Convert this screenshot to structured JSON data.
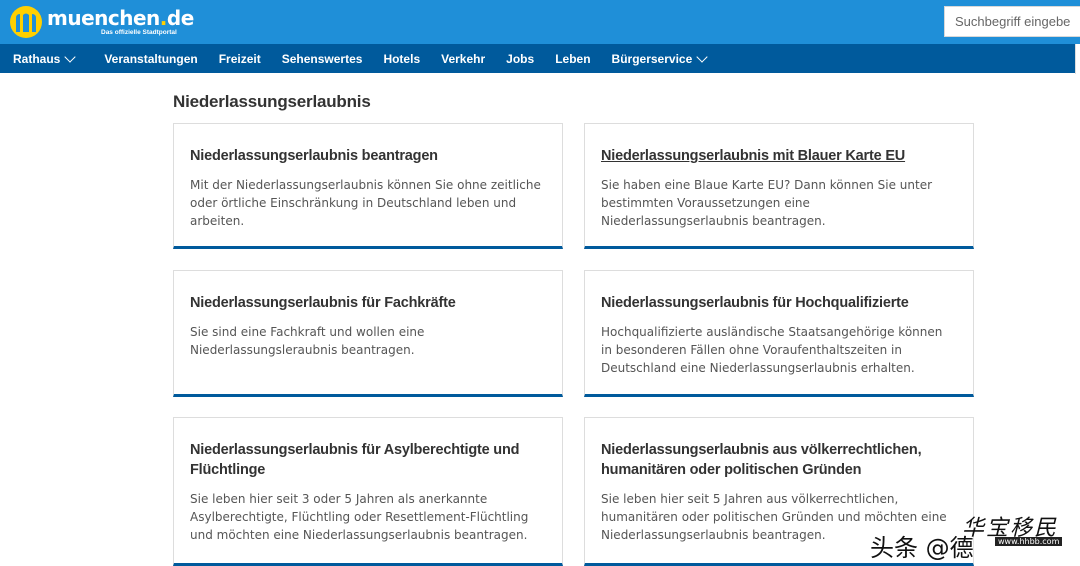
{
  "header": {
    "logo_word": "muenchen",
    "logo_dot": ".",
    "logo_tld": "de",
    "logo_subtitle": "Das offizielle Stadtportal",
    "search_placeholder": "Suchbegriff eingeben"
  },
  "nav": {
    "items": [
      {
        "label": "Rathaus",
        "has_dropdown": true
      },
      {
        "label": "Veranstaltungen"
      },
      {
        "label": "Freizeit"
      },
      {
        "label": "Sehenswertes"
      },
      {
        "label": "Hotels"
      },
      {
        "label": "Verkehr"
      },
      {
        "label": "Jobs"
      },
      {
        "label": "Leben"
      },
      {
        "label": "Bürgerservice",
        "has_dropdown": true
      }
    ]
  },
  "page": {
    "title": "Niederlassungserlaubnis"
  },
  "cards": [
    {
      "title": "Niederlassungserlaubnis beantragen",
      "text": "Mit der Niederlassungserlaubnis können Sie ohne zeitliche oder örtliche Einschränkung in Deutschland leben und arbeiten."
    },
    {
      "title": "Niederlassungserlaubnis mit Blauer Karte EU",
      "text": "Sie haben eine Blaue Karte EU? Dann können Sie unter bestimmten Voraussetzungen eine Niederlassungserlaubnis beantragen."
    },
    {
      "title": "Niederlassungserlaubnis für Fachkräfte",
      "text": "Sie sind eine Fachkraft und wollen eine Niederlassungsleraubnis beantragen."
    },
    {
      "title": "Niederlassungserlaubnis für Hochqualifizierte",
      "text": "Hochqualifizierte ausländische Staatsangehörige können in besonderen Fällen ohne Voraufenthaltszeiten in Deutschland eine Niederlassungserlaubnis erhalten."
    },
    {
      "title": "Niederlassungserlaubnis für Asylberechtigte und Flüchtlinge",
      "text": "Sie leben hier seit 3 oder 5 Jahren als anerkannte Asylberechtigte, Flüchtling oder Resettlement-Flüchtling und möchten eine Niederlassungserlaubnis beantragen."
    },
    {
      "title": "Niederlassungserlaubnis aus völkerrechtlichen, humanitären oder politischen Gründen",
      "text": "Sie leben hier seit 5 Jahren aus völkerrechtlichen, humanitären oder politischen Gründen und möchten eine Niederlassungserlaubnis beantragen."
    }
  ],
  "watermark": {
    "left": "头条 @德",
    "right": "华宝移民",
    "url": "www.hhbb.com"
  },
  "colors": {
    "topbar": "#1f8fd8",
    "navbar": "#005a9c",
    "logo_yellow": "#ffd000",
    "card_accent": "#005a9c"
  }
}
